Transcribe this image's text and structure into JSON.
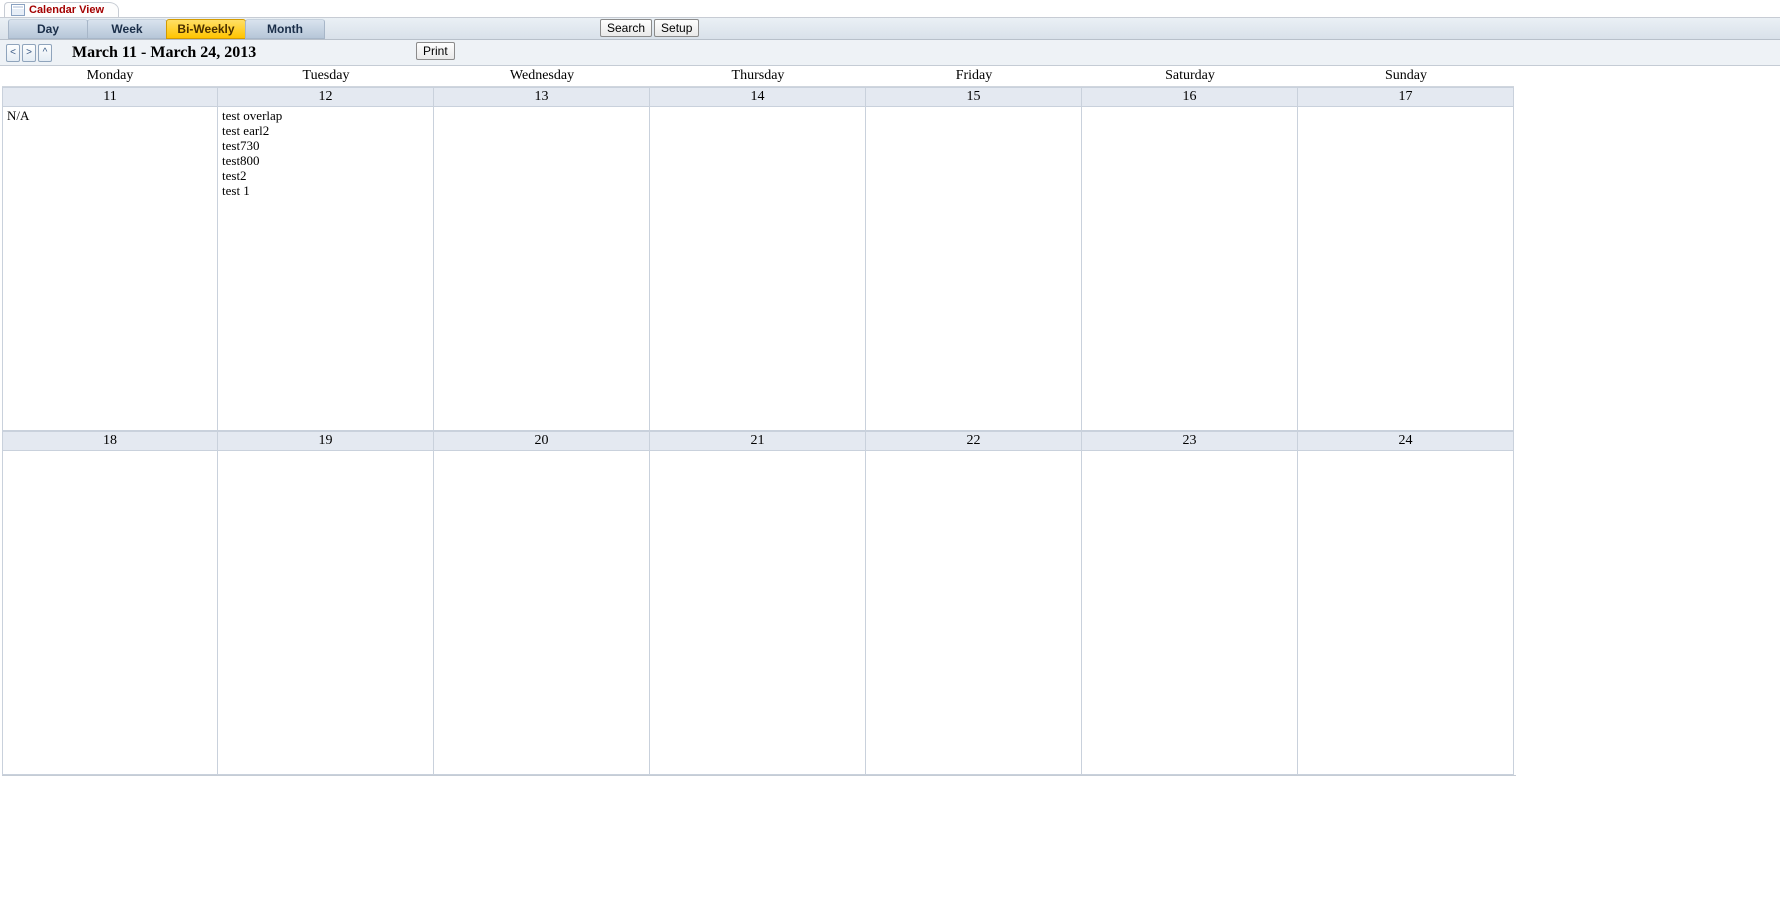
{
  "tab": {
    "title": "Calendar View"
  },
  "view_tabs": {
    "0": "Day",
    "1": "Week",
    "2": "Bi-Weekly",
    "3": "Month",
    "active_index": 2
  },
  "toolbar": {
    "search": "Search",
    "setup": "Setup",
    "print": "Print"
  },
  "nav": {
    "prev": "<",
    "next": ">",
    "up": "^",
    "title": "March 11 - March 24, 2013"
  },
  "weekdays": {
    "0": "Monday",
    "1": "Tuesday",
    "2": "Wednesday",
    "3": "Thursday",
    "4": "Friday",
    "5": "Saturday",
    "6": "Sunday"
  },
  "week1_dates": {
    "0": "11",
    "1": "12",
    "2": "13",
    "3": "14",
    "4": "15",
    "5": "16",
    "6": "17"
  },
  "week2_dates": {
    "0": "18",
    "1": "19",
    "2": "20",
    "3": "21",
    "4": "22",
    "5": "23",
    "6": "24"
  },
  "cells": {
    "w1d0": {
      "0": "N/A"
    },
    "w1d1": {
      "0": "test overlap",
      "1": "test earl2",
      "2": "test730",
      "3": "test800",
      "4": "test2",
      "5": "test 1"
    }
  }
}
